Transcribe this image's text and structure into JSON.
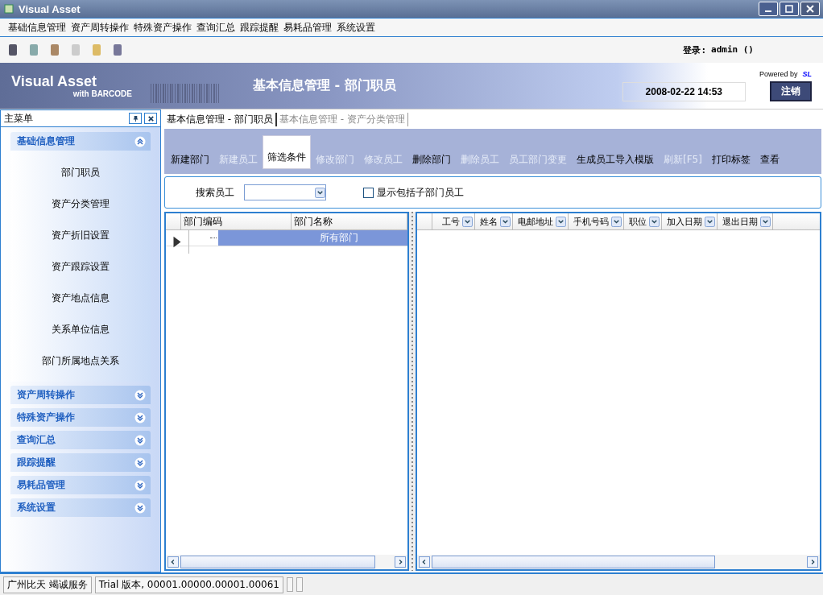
{
  "window": {
    "title": "Visual Asset"
  },
  "menu": [
    "基础信息管理",
    "资产周转操作",
    "特殊资产操作",
    "查询汇总",
    "跟踪提醒",
    "易耗品管理",
    "系统设置"
  ],
  "login": {
    "label": "登录:",
    "user": "admin ()"
  },
  "banner": {
    "logo": "Visual Asset",
    "logo_sub": "with BARCODE",
    "title": "基本信息管理 - 部门职员",
    "powered_by": "Powered by",
    "powered_brand": "SL",
    "datetime": "2008-02-22 14:53",
    "logout": "注销"
  },
  "sidebar": {
    "title": "主菜单",
    "groups": [
      {
        "label": "基础信息管理",
        "expanded": true,
        "items": [
          "部门职员",
          "资产分类管理",
          "资产折旧设置",
          "资产跟踪设置",
          "资产地点信息",
          "关系单位信息",
          "部门所属地点关系"
        ]
      },
      {
        "label": "资产周转操作",
        "expanded": false
      },
      {
        "label": "特殊资产操作",
        "expanded": false
      },
      {
        "label": "查询汇总",
        "expanded": false
      },
      {
        "label": "跟踪提醒",
        "expanded": false
      },
      {
        "label": "易耗品管理",
        "expanded": false
      },
      {
        "label": "系统设置",
        "expanded": false
      }
    ]
  },
  "doc_tabs": [
    {
      "label": "基本信息管理 - 部门职员",
      "selected": true
    },
    {
      "label": "基本信息管理 - 资产分类管理",
      "selected": false
    }
  ],
  "actions": [
    {
      "label": "新建部门",
      "disabled": false,
      "selected": false
    },
    {
      "label": "新建员工",
      "disabled": true,
      "selected": false
    },
    {
      "label": "筛选条件",
      "disabled": false,
      "selected": true
    },
    {
      "label": "修改部门",
      "disabled": true,
      "selected": false
    },
    {
      "label": "修改员工",
      "disabled": true,
      "selected": false
    },
    {
      "label": "删除部门",
      "disabled": false,
      "selected": false
    },
    {
      "label": "删除员工",
      "disabled": true,
      "selected": false
    },
    {
      "label": "员工部门变更",
      "disabled": true,
      "selected": false
    },
    {
      "label": "生成员工导入模版",
      "disabled": false,
      "selected": false
    },
    {
      "label": "刷新[F5]",
      "disabled": true,
      "selected": false
    },
    {
      "label": "打印标签",
      "disabled": false,
      "selected": false
    },
    {
      "label": "查看",
      "disabled": false,
      "selected": false
    }
  ],
  "filter": {
    "search_label": "搜索员工",
    "include_sub": {
      "label": "显示包括子部门员工",
      "checked": false
    }
  },
  "dept_table": {
    "columns": [
      "部门编码",
      "部门名称"
    ],
    "rows": [
      {
        "name": "所有部门",
        "selected": true
      }
    ]
  },
  "staff_table": {
    "columns": [
      "工号",
      "姓名",
      "电邮地址",
      "手机号码",
      "职位",
      "加入日期",
      "退出日期"
    ]
  },
  "status_bar": [
    "广州比天 竭诚服务",
    "Trial 版本, 00001.00000.00001.00061"
  ]
}
